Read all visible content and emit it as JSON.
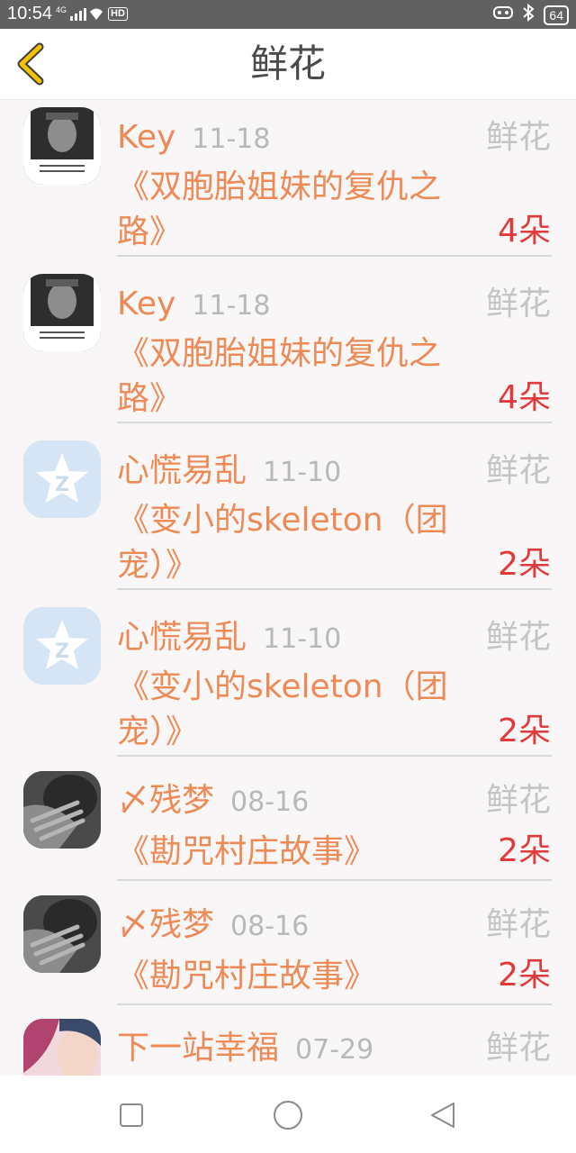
{
  "status": {
    "time": "10:54",
    "network": "4G",
    "hd": "HD",
    "battery": "64"
  },
  "header": {
    "title": "鲜花",
    "back_icon": "chevron-left-icon",
    "accent": "#f2c200"
  },
  "items": [
    {
      "name": "Key",
      "date": "11-18",
      "kind": "鲜花",
      "book_line1": "《双胞胎姐妹的复仇之",
      "book_line2": "路》",
      "count": "4朵",
      "avatar": "photo-avatar"
    },
    {
      "name": "Key",
      "date": "11-18",
      "kind": "鲜花",
      "book_line1": "《双胞胎姐妹的复仇之",
      "book_line2": "路》",
      "count": "4朵",
      "avatar": "photo-avatar"
    },
    {
      "name": "心慌易乱",
      "date": "11-10",
      "kind": "鲜花",
      "book_line1": "《变小的skeleton（团",
      "book_line2": "宠）》",
      "count": "2朵",
      "avatar": "qq-default-avatar"
    },
    {
      "name": "心慌易乱",
      "date": "11-10",
      "kind": "鲜花",
      "book_line1": "《变小的skeleton（团",
      "book_line2": "宠）》",
      "count": "2朵",
      "avatar": "qq-default-avatar"
    },
    {
      "name": "〆残梦",
      "date": "08-16",
      "kind": "鲜花",
      "book_line1": "《勘咒村庄故事》",
      "book_line2": "",
      "count": "2朵",
      "avatar": "hand-photo-avatar"
    },
    {
      "name": "〆残梦",
      "date": "08-16",
      "kind": "鲜花",
      "book_line1": "《勘咒村庄故事》",
      "book_line2": "",
      "count": "2朵",
      "avatar": "hand-photo-avatar"
    },
    {
      "name": "下一站幸福",
      "date": "07-29",
      "kind": "鲜花",
      "book_line1": "",
      "book_line2": "",
      "count": "",
      "avatar": "anime-avatar"
    }
  ],
  "colors": {
    "name": "#ee8a55",
    "count": "#e23a3a",
    "muted": "#b8b8b8"
  }
}
